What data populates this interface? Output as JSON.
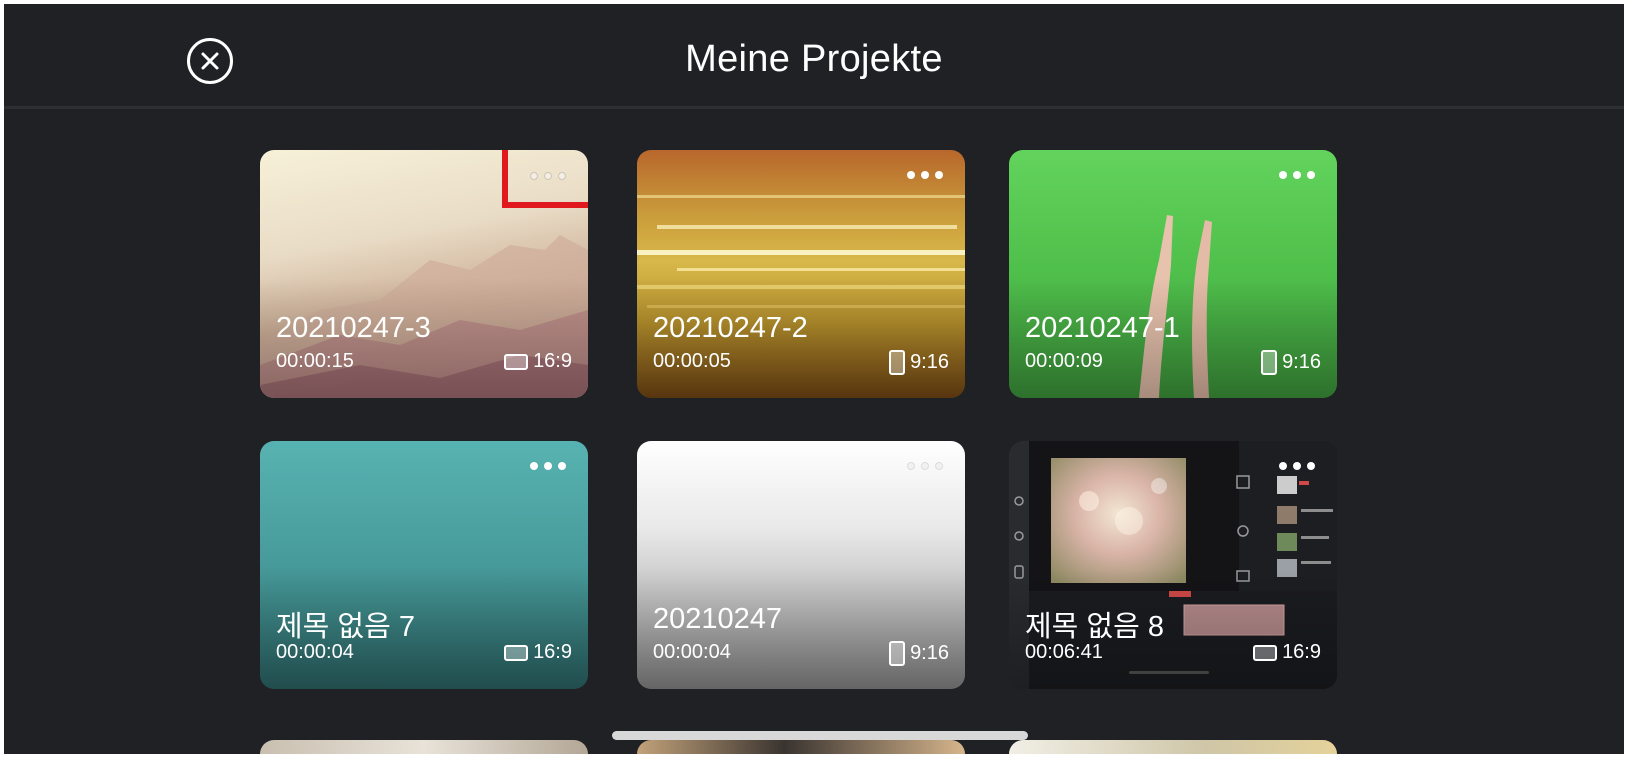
{
  "header": {
    "title": "Meine Projekte",
    "close_icon": "close-circle-icon"
  },
  "projects": [
    {
      "name": "20210247-3",
      "duration": "00:00:15",
      "ratio": "16:9",
      "orientation": "landscape"
    },
    {
      "name": "20210247-2",
      "duration": "00:00:05",
      "ratio": "9:16",
      "orientation": "portrait"
    },
    {
      "name": "20210247-1",
      "duration": "00:00:09",
      "ratio": "9:16",
      "orientation": "portrait"
    },
    {
      "name": "제목 없음 7",
      "duration": "00:00:04",
      "ratio": "16:9",
      "orientation": "landscape"
    },
    {
      "name": "20210247",
      "duration": "00:00:04",
      "ratio": "9:16",
      "orientation": "portrait"
    },
    {
      "name": "제목 없음 8",
      "duration": "00:06:41",
      "ratio": "16:9",
      "orientation": "landscape"
    }
  ],
  "more_icon": "more-horizontal-icon",
  "highlight_color": "#e0191f"
}
